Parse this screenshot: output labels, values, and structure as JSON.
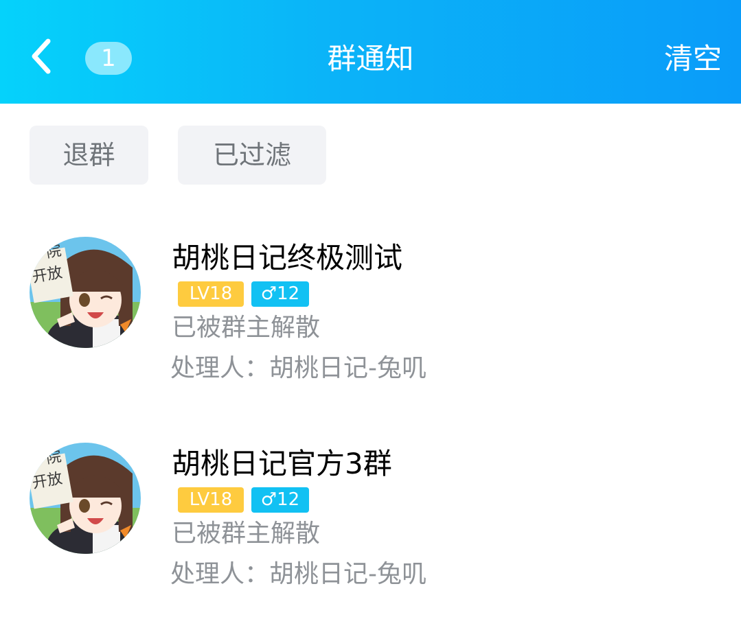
{
  "header": {
    "unread_count": "1",
    "title": "群通知",
    "clear_label": "清空",
    "gradient_start": "#05d2fb",
    "gradient_end": "#0a9cf9"
  },
  "filters": {
    "quit_label": "退群",
    "filtered_label": "已过滤"
  },
  "notifications": [
    {
      "group_name": "胡桃日记终极测试",
      "level_badge": "LV18",
      "gender_badge": "♂12",
      "status": "已被群主解散",
      "handler": "处理人：胡桃日记-兔叽",
      "avatar_text": "院\n开放"
    },
    {
      "group_name": "胡桃日记官方3群",
      "level_badge": "LV18",
      "gender_badge": "♂12",
      "status": "已被群主解散",
      "handler": "处理人：胡桃日记-兔叽",
      "avatar_text": "院\n开放"
    }
  ],
  "colors": {
    "level_badge": "#fecb3f",
    "gender_badge": "#12c1f3",
    "chip_background": "#f2f3f6",
    "secondary_text": "#8e9297"
  },
  "icons": {
    "back": "chevron-left-icon"
  }
}
